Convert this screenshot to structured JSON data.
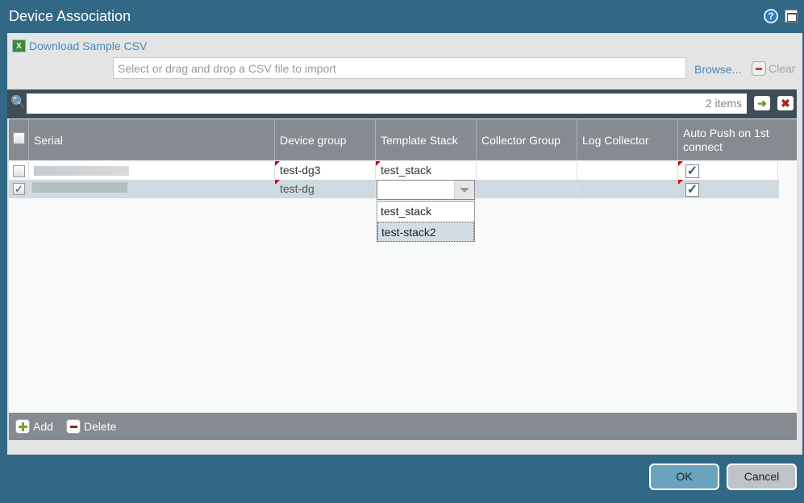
{
  "title": "Device Association",
  "download_label": "Download Sample CSV",
  "file_placeholder": "Select or drag and drop a CSV file to import",
  "browse_label": "Browse...",
  "clear_label": "Clear",
  "search": {
    "value": "",
    "count": "2 items"
  },
  "columns": [
    "Serial",
    "Device group",
    "Template Stack",
    "Collector Group",
    "Log Collector",
    "Auto Push on 1st connect"
  ],
  "rows": [
    {
      "checked": false,
      "serial": "",
      "device_group": "test-dg3",
      "template_stack": "test_stack",
      "collector_group": "",
      "log_collector": "",
      "auto_push": true
    },
    {
      "checked": true,
      "serial": "",
      "device_group": "test-dg",
      "template_stack": "",
      "collector_group": "",
      "log_collector": "",
      "auto_push": true
    }
  ],
  "dropdown_options": [
    "test_stack",
    "test-stack2"
  ],
  "footer": {
    "add": "Add",
    "delete": "Delete"
  },
  "buttons": {
    "ok": "OK",
    "cancel": "Cancel"
  }
}
